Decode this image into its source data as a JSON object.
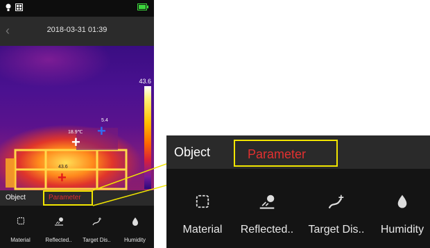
{
  "status_bar": {
    "icons": [
      "bulb-icon",
      "gallery-icon",
      "battery-icon"
    ]
  },
  "header": {
    "back_icon": "chevron-left-icon",
    "timestamp": "2018-03-31 01:39"
  },
  "thermal": {
    "scale_max": "43.6",
    "spot1_temp": "18.9℃",
    "spot2_temp": "5.4",
    "spot3_temp": "43.6"
  },
  "tabs": {
    "object": "Object",
    "parameter": "Parameter"
  },
  "params": [
    {
      "label": "Material",
      "icon": "material-icon"
    },
    {
      "label": "Reflected..",
      "icon": "reflected-icon"
    },
    {
      "label": "Target Dis..",
      "icon": "target-distance-icon"
    },
    {
      "label": "Humidity",
      "icon": "humidity-icon"
    }
  ],
  "colors": {
    "highlight": "#f2e600",
    "active_tab": "#e33030",
    "background": "#141414"
  }
}
